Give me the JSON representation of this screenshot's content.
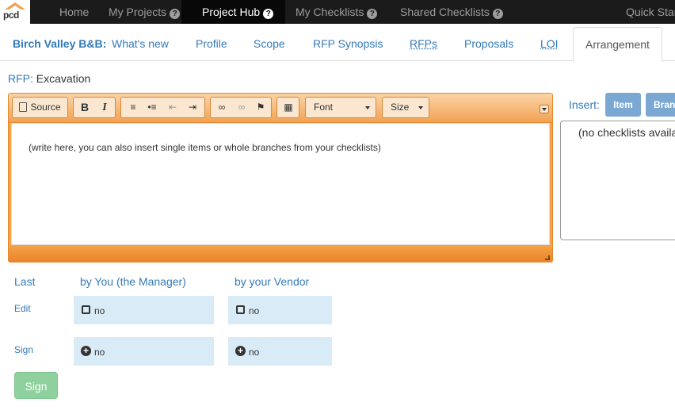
{
  "nav": {
    "logo_text": "pcd",
    "items": [
      {
        "label": "Home"
      },
      {
        "label": "My Projects"
      },
      {
        "label": "Project Hub"
      },
      {
        "label": "My Checklists"
      },
      {
        "label": "Shared Checklists"
      },
      {
        "label": "Quick Start"
      }
    ]
  },
  "tabs": {
    "project": "Birch Valley B&B:",
    "items": [
      "What's new",
      "Profile",
      "Scope",
      "RFP Synopsis",
      "RFPs",
      "Proposals",
      "LOI",
      "Arrangement"
    ],
    "active": "Arrangement"
  },
  "rfp": {
    "label": "RFP:",
    "value": "Excavation"
  },
  "editor": {
    "toolbar": {
      "source": "Source",
      "bold": "B",
      "italic": "I",
      "font": "Font",
      "size": "Size"
    },
    "placeholder": "(write here, you can also insert single items or whole branches from your checklists)"
  },
  "insert": {
    "label": "Insert:",
    "item_button": "Item",
    "branch_button": "Branch",
    "empty_text": "(no checklists available)"
  },
  "approval": {
    "header_last": "Last",
    "header_manager": "by You (the Manager)",
    "header_vendor": "by your Vendor",
    "rows": [
      {
        "label": "Edit",
        "manager": "no",
        "vendor": "no"
      },
      {
        "label": "Sign",
        "manager": "no",
        "vendor": "no"
      }
    ]
  },
  "sign_button": "Sign",
  "colors": {
    "nav_bg": "#1b1b1b",
    "link": "#337ab7",
    "editor_orange": "#f6a24a",
    "cell_bg": "#d9ebf6",
    "sign_green": "#8fd19e"
  }
}
